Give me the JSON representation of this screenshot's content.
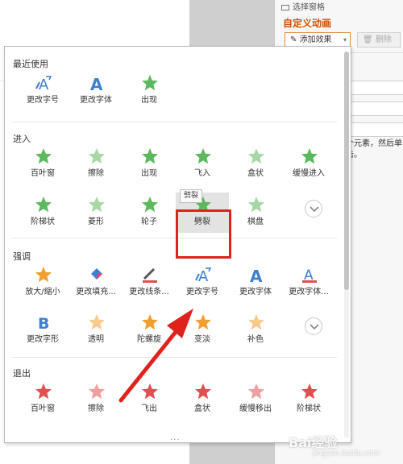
{
  "background": {
    "selection_pane_label": "选择窗格",
    "custom_animation_title": "自定义动画",
    "add_effect_label": "添加效果",
    "delete_label": "删除",
    "hint_text": "个元素，然后单击。"
  },
  "sections": [
    {
      "title": "最近使用",
      "items": [
        {
          "label": "更改字号",
          "icon": "font-size-icon"
        },
        {
          "label": "更改字体",
          "icon": "font-icon"
        },
        {
          "label": "出现",
          "icon": "star-icon"
        }
      ]
    },
    {
      "title": "进入",
      "items": [
        {
          "label": "百叶窗",
          "icon": "star-icon"
        },
        {
          "label": "擦除",
          "icon": "star-icon"
        },
        {
          "label": "出现",
          "icon": "star-icon"
        },
        {
          "label": "飞入",
          "icon": "star-icon"
        },
        {
          "label": "盒状",
          "icon": "star-icon"
        },
        {
          "label": "缓慢进入",
          "icon": "star-icon"
        },
        {
          "label": "阶梯状",
          "icon": "star-icon"
        },
        {
          "label": "菱形",
          "icon": "star-icon"
        },
        {
          "label": "轮子",
          "icon": "star-icon"
        },
        {
          "label": "劈裂",
          "icon": "star-icon"
        },
        {
          "label": "棋盘",
          "icon": "star-icon"
        }
      ]
    },
    {
      "title": "强调",
      "items": [
        {
          "label": "放大/缩小",
          "icon": "star-icon"
        },
        {
          "label": "更改填充...",
          "icon": "fill-icon"
        },
        {
          "label": "更改线条...",
          "icon": "line-icon"
        },
        {
          "label": "更改字号",
          "icon": "font-size-icon"
        },
        {
          "label": "更改字体",
          "icon": "font-icon"
        },
        {
          "label": "更改字体...",
          "icon": "font-color-icon"
        },
        {
          "label": "更改字形",
          "icon": "bold-icon"
        },
        {
          "label": "透明",
          "icon": "star-icon"
        },
        {
          "label": "陀螺旋",
          "icon": "star-icon"
        },
        {
          "label": "变淡",
          "icon": "star-icon"
        },
        {
          "label": "补色",
          "icon": "star-icon"
        }
      ]
    },
    {
      "title": "退出",
      "items": [
        {
          "label": "百叶窗",
          "icon": "star-icon"
        },
        {
          "label": "擦除",
          "icon": "star-icon"
        },
        {
          "label": "飞出",
          "icon": "star-icon"
        },
        {
          "label": "盒状",
          "icon": "star-icon"
        },
        {
          "label": "缓慢移出",
          "icon": "star-icon"
        },
        {
          "label": "阶梯状",
          "icon": "star-icon"
        }
      ]
    }
  ],
  "tooltip": "劈裂",
  "bottom_dots": "...",
  "watermark": "Bai经验",
  "watermark_sub": "jingyan.baidu.com",
  "colors": {
    "green": "#5cb85c",
    "orange": "#f0a030",
    "red": "#e05050",
    "blue": "#3f7fd0",
    "highlight": "#e0221d"
  }
}
